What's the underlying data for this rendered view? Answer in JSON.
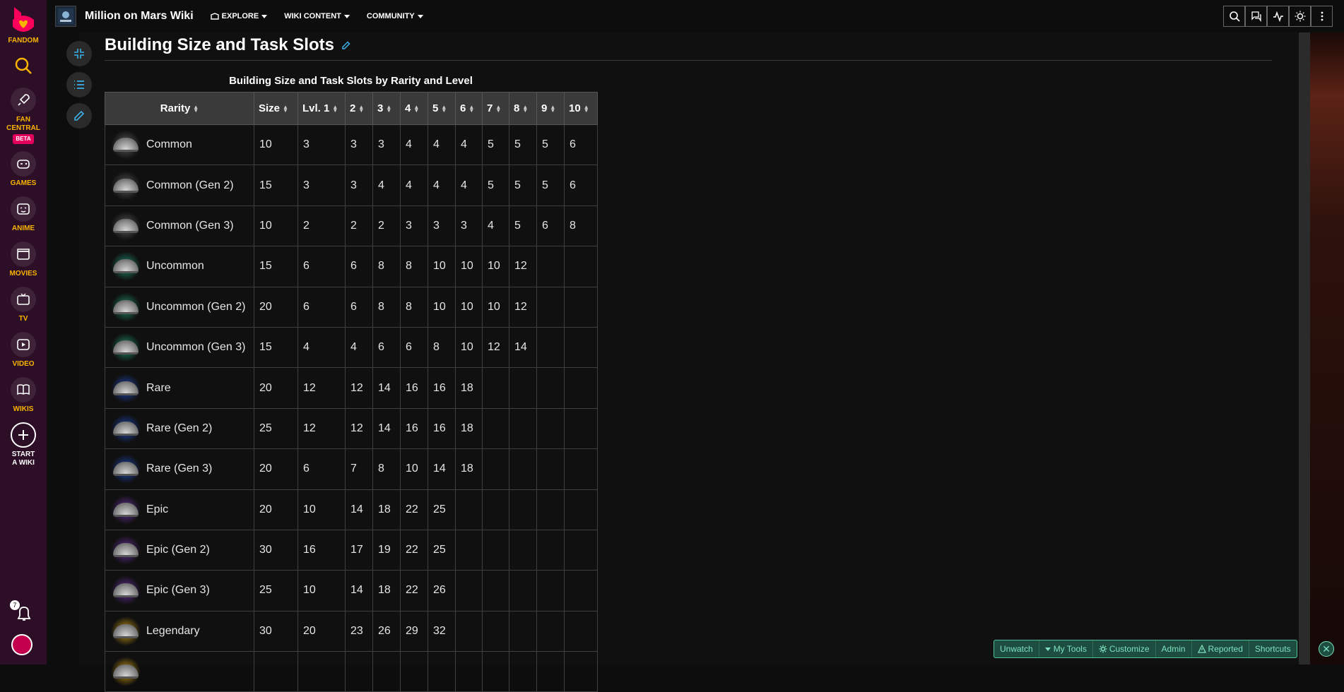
{
  "rail": {
    "fandom_label": "FANDOM",
    "items": [
      {
        "label": "FAN CENTRAL",
        "icon": "rocket-icon",
        "beta": "BETA"
      },
      {
        "label": "GAMES",
        "icon": "gamepad-icon"
      },
      {
        "label": "ANIME",
        "icon": "anime-icon"
      },
      {
        "label": "MOVIES",
        "icon": "clapper-icon"
      },
      {
        "label": "TV",
        "icon": "tv-icon"
      },
      {
        "label": "VIDEO",
        "icon": "video-icon"
      },
      {
        "label": "WIKIS",
        "icon": "book-icon"
      },
      {
        "label": "START A WIKI",
        "icon": "plus-icon"
      }
    ],
    "notification_count": "7"
  },
  "topbar": {
    "wiki_name": "Million on Mars Wiki",
    "nav": [
      "EXPLORE",
      "WIKI CONTENT",
      "COMMUNITY"
    ]
  },
  "page": {
    "title": "Building Size and Task Slots",
    "table_caption": "Building Size and Task Slots by Rarity and Level",
    "columns": [
      "Rarity",
      "Size",
      "Lvl. 1",
      "2",
      "3",
      "4",
      "5",
      "6",
      "7",
      "8",
      "9",
      "10"
    ],
    "rows": [
      {
        "rarity": "Common",
        "glow": "#5a5a5a",
        "cells": [
          "10",
          "3",
          "3",
          "3",
          "4",
          "4",
          "4",
          "5",
          "5",
          "5",
          "6"
        ]
      },
      {
        "rarity": "Common (Gen 2)",
        "glow": "#5a5a5a",
        "cells": [
          "15",
          "3",
          "3",
          "4",
          "4",
          "4",
          "4",
          "5",
          "5",
          "5",
          "6"
        ]
      },
      {
        "rarity": "Common (Gen 3)",
        "glow": "#5a5a5a",
        "cells": [
          "10",
          "2",
          "2",
          "2",
          "3",
          "3",
          "3",
          "4",
          "5",
          "6",
          "8"
        ]
      },
      {
        "rarity": "Uncommon",
        "glow": "#1f8f6e",
        "cells": [
          "15",
          "6",
          "6",
          "8",
          "8",
          "10",
          "10",
          "10",
          "12",
          "",
          ""
        ]
      },
      {
        "rarity": "Uncommon (Gen 2)",
        "glow": "#1f8f6e",
        "cells": [
          "20",
          "6",
          "6",
          "8",
          "8",
          "10",
          "10",
          "10",
          "12",
          "",
          ""
        ]
      },
      {
        "rarity": "Uncommon (Gen 3)",
        "glow": "#1f8f6e",
        "cells": [
          "15",
          "4",
          "4",
          "6",
          "6",
          "8",
          "10",
          "12",
          "14",
          "",
          ""
        ]
      },
      {
        "rarity": "Rare",
        "glow": "#1d48b8",
        "cells": [
          "20",
          "12",
          "12",
          "14",
          "16",
          "16",
          "18",
          "",
          "",
          "",
          ""
        ]
      },
      {
        "rarity": "Rare (Gen 2)",
        "glow": "#1d48b8",
        "cells": [
          "25",
          "12",
          "12",
          "14",
          "16",
          "16",
          "18",
          "",
          "",
          "",
          ""
        ]
      },
      {
        "rarity": "Rare (Gen 3)",
        "glow": "#1d48b8",
        "cells": [
          "20",
          "6",
          "7",
          "8",
          "10",
          "14",
          "18",
          "",
          "",
          "",
          ""
        ]
      },
      {
        "rarity": "Epic",
        "glow": "#6a2fa0",
        "cells": [
          "20",
          "10",
          "14",
          "18",
          "22",
          "25",
          "",
          "",
          "",
          "",
          ""
        ]
      },
      {
        "rarity": "Epic (Gen 2)",
        "glow": "#6a2fa0",
        "cells": [
          "30",
          "16",
          "17",
          "19",
          "22",
          "25",
          "",
          "",
          "",
          "",
          ""
        ]
      },
      {
        "rarity": "Epic (Gen 3)",
        "glow": "#6a2fa0",
        "cells": [
          "25",
          "10",
          "14",
          "18",
          "22",
          "26",
          "",
          "",
          "",
          "",
          ""
        ]
      },
      {
        "rarity": "Legendary",
        "glow": "#c99a12",
        "cells": [
          "30",
          "20",
          "23",
          "26",
          "29",
          "32",
          "",
          "",
          "",
          "",
          ""
        ]
      },
      {
        "rarity": "",
        "glow": "#c99a12",
        "cells": [
          "",
          "",
          "",
          "",
          "",
          "",
          "",
          "",
          "",
          "",
          ""
        ]
      }
    ]
  },
  "tools_bar": {
    "items": [
      "Unwatch",
      "My Tools",
      "Customize",
      "Admin",
      "Reported",
      "Shortcuts"
    ]
  }
}
